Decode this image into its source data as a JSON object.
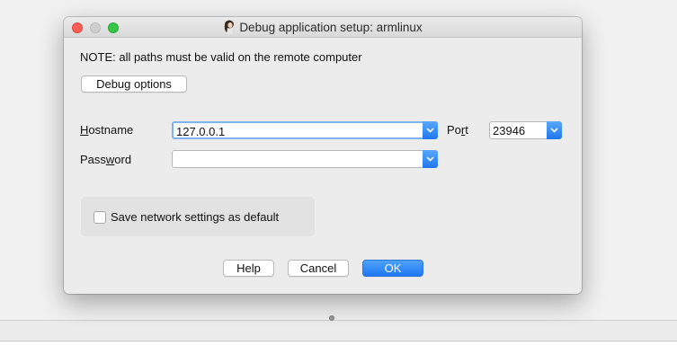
{
  "dialog": {
    "title": "Debug application setup: armlinux",
    "title_icon": "ida-icon"
  },
  "note": "NOTE: all paths must be valid on the remote computer",
  "buttons": {
    "debug_options": "Debug options",
    "help": "Help",
    "cancel": "Cancel",
    "ok": "OK"
  },
  "fields": {
    "hostname": {
      "label_accel": "H",
      "label_rest": "ostname",
      "value": "127.0.0.1"
    },
    "password": {
      "label_pre": "Pass",
      "label_accel": "w",
      "label_post": "ord",
      "value": ""
    },
    "port": {
      "label_pre": "Po",
      "label_accel": "r",
      "label_post": "t",
      "value": "23946"
    }
  },
  "save_default": {
    "label": "Save network settings as default",
    "checked": false
  },
  "colors": {
    "accent": "#1f78f2",
    "close": "#fd5f57",
    "maximize": "#36c748"
  }
}
